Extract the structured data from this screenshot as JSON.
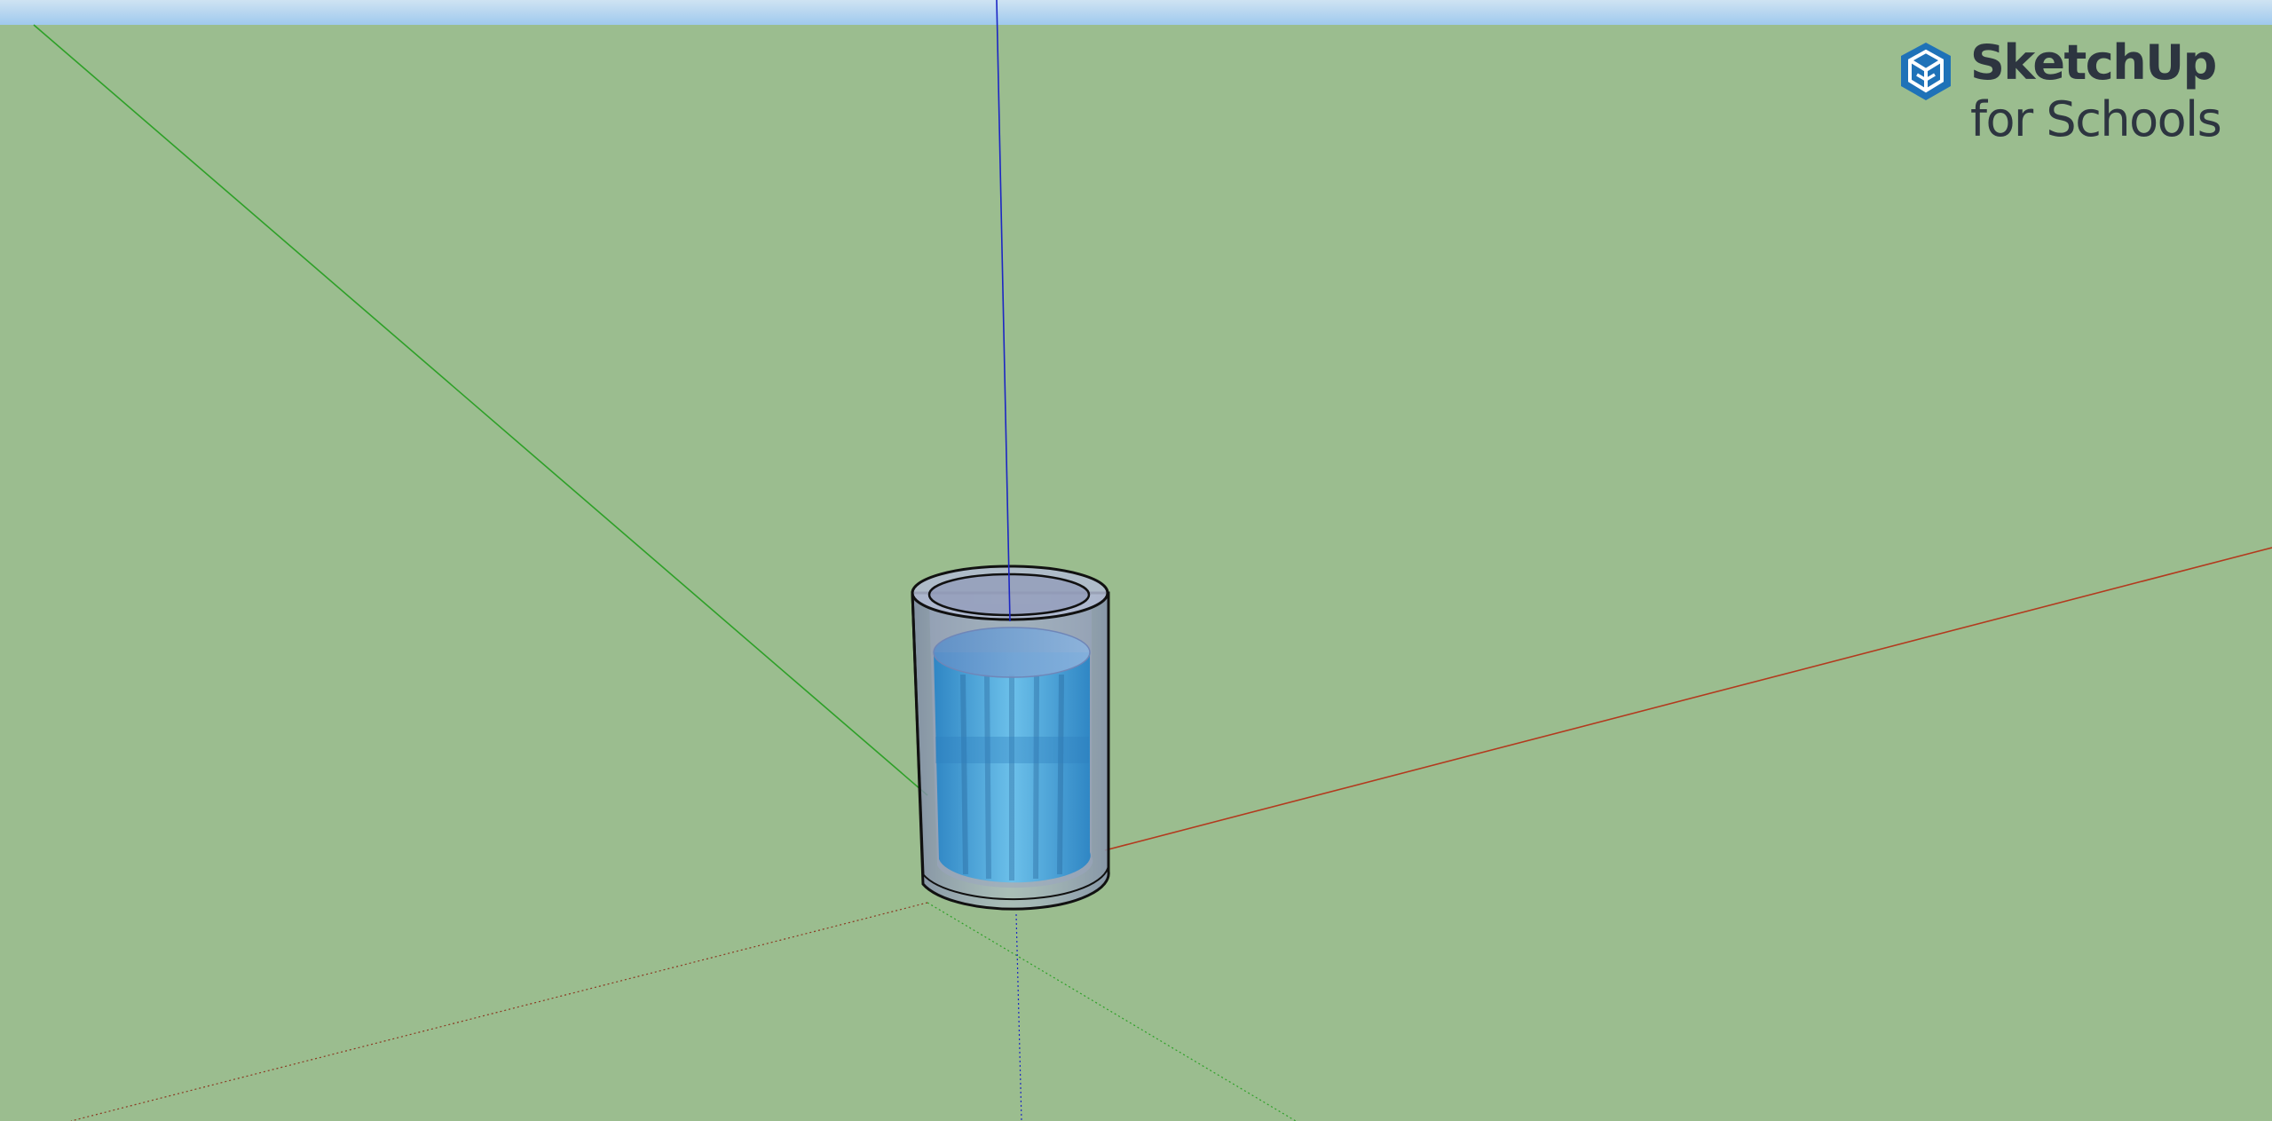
{
  "app": {
    "brand_name": "SketchUp",
    "brand_sub": "for Schools",
    "logo_icon": "sketchup-logo-icon"
  },
  "colors": {
    "ground": "#9bbd8f",
    "sky_top": "#cfe3f2",
    "sky_bottom": "#9fc9ee",
    "logo_text": "#2d3540",
    "logo_mark": "#1f72b8",
    "axis_red": "#b33a1e",
    "axis_green": "#2ea028",
    "axis_blue": "#1c26c4",
    "water": "#4aa3d8",
    "glass": "#aeb8cc",
    "edge": "#111111"
  },
  "scene": {
    "model": "glass-of-water",
    "axes": [
      "red-axis",
      "green-axis",
      "blue-axis"
    ]
  }
}
